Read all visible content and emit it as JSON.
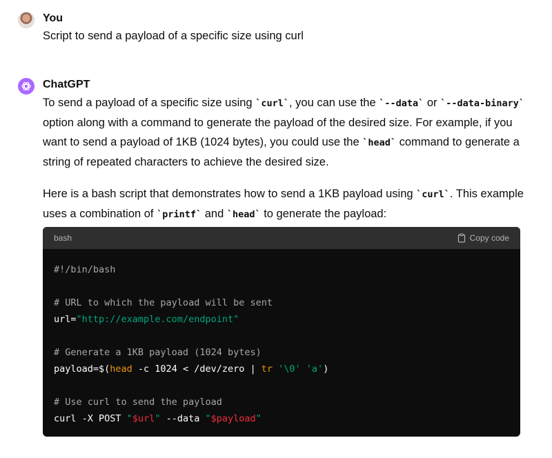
{
  "user_message": {
    "author": "You",
    "text": "Script to send a payload of a specific size using curl"
  },
  "assistant_message": {
    "author": "ChatGPT",
    "p1": {
      "a": "To send a payload of a specific size using ",
      "code1": "`curl`",
      "b": ", you can use the ",
      "code2": "`--data`",
      "c": " or ",
      "code3": "`--data-binary`",
      "d": " option along with a command to generate the payload of the desired size. For example, if you want to send a payload of 1KB (1024 bytes), you could use the ",
      "code4": "`head`",
      "e": " command to generate a string of repeated characters to achieve the desired size."
    },
    "p2": {
      "a": "Here is a bash script that demonstrates how to send a 1KB payload using ",
      "code1": "`curl`",
      "b": ". This example uses a combination of ",
      "code2": "`printf`",
      "c": " and ",
      "code3": "`head`",
      "d": " to generate the payload:"
    },
    "code_block": {
      "language": "bash",
      "copy_label": "Copy code",
      "l1": "#!/bin/bash",
      "l3": "# URL to which the payload will be sent",
      "l4_a": "url=",
      "l4_b": "\"http://example.com/endpoint\"",
      "l6": "# Generate a 1KB payload (1024 bytes)",
      "l7_a": "payload=$(",
      "l7_b": "head",
      "l7_c": " -c 1024 < /dev/zero | ",
      "l7_d": "tr",
      "l7_e": " ",
      "l7_f": "'\\0'",
      "l7_g": " ",
      "l7_h": "'a'",
      "l7_i": ")",
      "l9": "# Use curl to send the payload",
      "l10_a": "curl -X POST ",
      "l10_b": "\"",
      "l10_c": "$url",
      "l10_d": "\"",
      "l10_e": " --data ",
      "l10_f": "\"",
      "l10_g": "$payload",
      "l10_h": "\""
    }
  },
  "colors": {
    "code_bg": "#0d0d0d",
    "code_header_bg": "#2f2f2f",
    "string_green": "#00a67d",
    "variable_red": "#f22c3d",
    "builtin_orange": "#e9950c",
    "comment_gray": "#a8a8a8",
    "gpt_avatar": "#ab68ff"
  },
  "icons": [
    "user-avatar",
    "chatgpt-logo-icon",
    "clipboard-icon"
  ]
}
